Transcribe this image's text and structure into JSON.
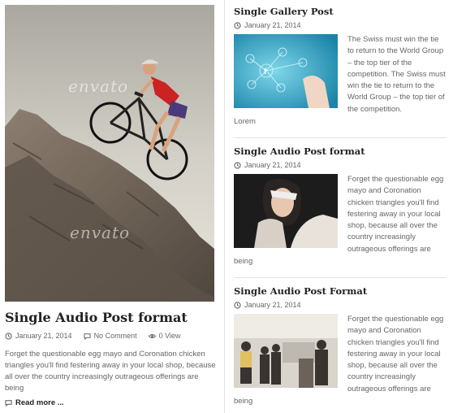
{
  "featured": {
    "watermark": "envato",
    "title": "Single Audio Post format",
    "date": "January 21, 2014",
    "comments": "No Comment",
    "views": "0 View",
    "excerpt": "Forget the questionable egg mayo and Coronation chicken triangles you'll find festering away in your local shop, because all over the country increasingly outrageous offerings are being",
    "read_more": "Read more ..."
  },
  "posts": [
    {
      "title": "Single Gallery Post",
      "date": "January 21, 2014",
      "excerpt": "The Swiss must win the tie to return to the World Group – the top tier of the competition. The Swiss must win the tie to return to the World Group – the top tier of the competition.",
      "tail": "Lorem"
    },
    {
      "title": "Single Audio Post format",
      "date": "January 21, 2014",
      "excerpt": "Forget the questionable egg mayo and Coronation chicken triangles you'll find festering away in your local shop, because all over the country increasingly outrageous offerings are",
      "tail": "being"
    },
    {
      "title": "Single Audio Post Format",
      "date": "January 21, 2014",
      "excerpt": "Forget the questionable egg mayo and Coronation chicken triangles you'll find festering away in your local shop, because all over the country increasingly outrageous offerings are",
      "tail": "being"
    }
  ]
}
